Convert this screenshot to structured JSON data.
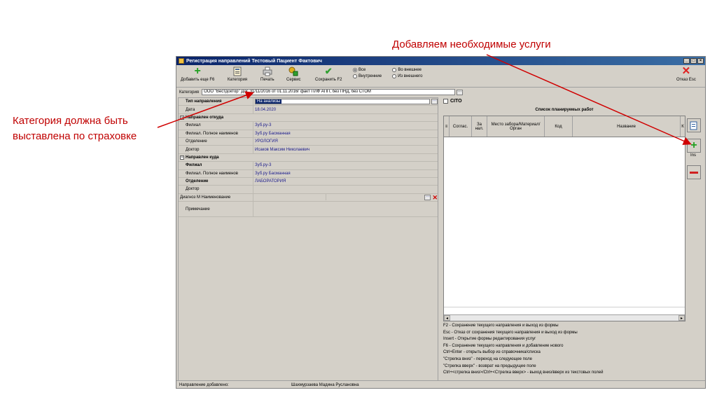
{
  "annotations": {
    "top": "Добавляем необходимые услуги",
    "left_line1": "Категория должна быть",
    "left_line2": "выставлена по страховке",
    "color": "#c00000"
  },
  "window": {
    "title": "Регистрация направлений Тестовый Пациент Фактович",
    "controls": [
      "_",
      "□",
      "×"
    ]
  },
  "toolbar": {
    "add": "Добавить еще F6",
    "category": "Категория",
    "print": "Печать",
    "service": "Сервис",
    "save": "Сохранить F2",
    "radio_all": "Все",
    "radio_to_external": "Во внешнее",
    "radio_internal": "Внутренние",
    "radio_from_external": "Из внешнего",
    "cancel": "Отказ Esc"
  },
  "category_bar": {
    "label": "Категория",
    "value": "ООО \"Вестдоктор\" Дог. 31/11/2016 от 01.11.2016г факт ПЛФ  АПП, без ПНД, без СТОМ",
    "dots": "···"
  },
  "props": {
    "type_label": "Тип направления",
    "type_value": "На анализы",
    "date_label": "Дата",
    "date_value": "18.04.2020",
    "from_header": "Направлен откуда",
    "from_branch_label": "Филиал",
    "from_branch_value": "Зуб.ру-3",
    "from_branch_full_label": "Филиал. Полное наименов",
    "from_branch_full_value": "Зуб.ру Басманная",
    "from_dept_label": "Отделение",
    "from_dept_value": "УРОЛОГИЯ",
    "from_doctor_label": "Доктор",
    "from_doctor_value": "Исаков Максим Николаевич",
    "to_header": "Направлен куда",
    "to_branch_label": "Филиал",
    "to_branch_value": "Зуб.ру-3",
    "to_branch_full_label": "Филиал. Полное наименов",
    "to_branch_full_value": "Зуб.ру Басманная",
    "to_dept_label": "Отделение",
    "to_dept_value": "ЛАБОРАТОРИЯ",
    "to_doctor_label": "Доктор",
    "to_doctor_value": "",
    "diag_label": "Диагноз М",
    "diag_name_label": "Наименование",
    "note_label": "Примечание",
    "collapse": "−",
    "dots": "···",
    "clear": "✕"
  },
  "right": {
    "cito": "CITO",
    "list_title": "Список планируемых работ",
    "columns": [
      "Согласование",
      "За нал.",
      "Место забора/Материал/Орган",
      "Код",
      "Название",
      "К"
    ],
    "columns_display": [
      "Соглас.",
      "За нал.",
      "Место забора/Материал/Орган",
      "Код",
      "Название",
      "К"
    ],
    "ins_label": "Ins",
    "scroll_left": "◂",
    "scroll_right": "▸"
  },
  "help": [
    "F2    - Сохранение текущего направления и выход из формы",
    "Esc    - Отказ от сохранения текущего направления и выход из формы",
    "Insert - Открытие формы редактирования услуг",
    "F6     - Сохранение текущего направления и добавление нового",
    "Ctrl+Enter    - открыть выбор из справочника/списка",
    "\"Стрелка вниз\"   - переход на следующее поле",
    "\"Стрелка вверх\" - возврат на предыдущее поле",
    "Ctrl+<стрелка вниз>/Ctrl+<Стрелка вверх> - выход вниз/вверх из текстовых полей"
  ],
  "status": {
    "label": "Направление добавлено:",
    "user": "Шахмурзаева Мадина Руслановна"
  }
}
